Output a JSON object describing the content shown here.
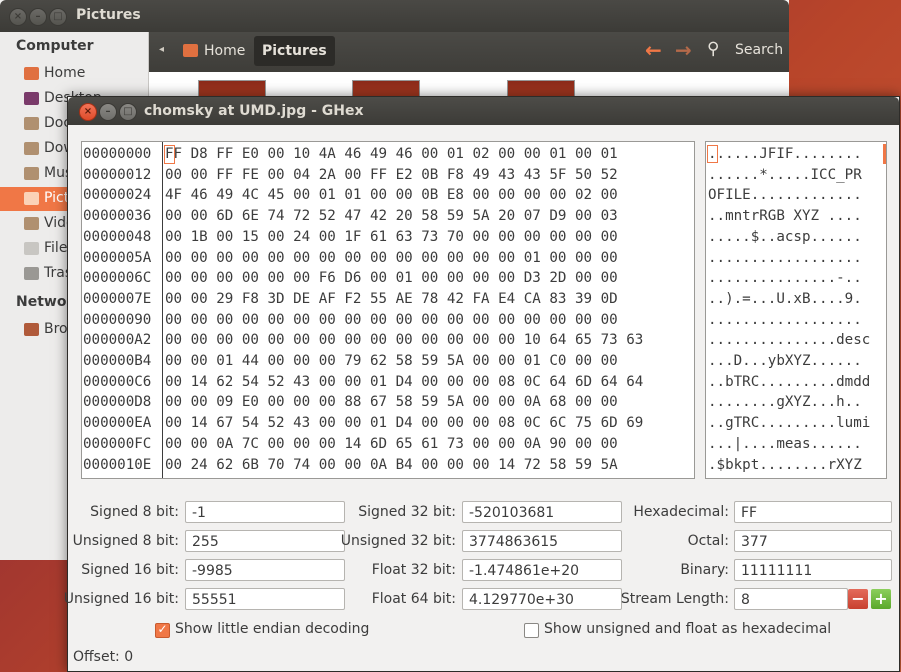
{
  "file_manager": {
    "title": "Pictures",
    "sidebar": {
      "computer_heading": "Computer",
      "items": [
        {
          "label": "Home",
          "icon": "home-folder-icon"
        },
        {
          "label": "Desktop",
          "icon": "desktop-icon"
        },
        {
          "label": "Documents",
          "icon": "documents-folder-icon"
        },
        {
          "label": "Downloads",
          "icon": "downloads-folder-icon"
        },
        {
          "label": "Music",
          "icon": "music-folder-icon"
        },
        {
          "label": "Pictures",
          "icon": "pictures-folder-icon",
          "selected": true
        },
        {
          "label": "Videos",
          "icon": "videos-folder-icon"
        },
        {
          "label": "File System",
          "icon": "filesystem-icon"
        },
        {
          "label": "Trash",
          "icon": "trash-icon"
        }
      ],
      "network_heading": "Network",
      "network_items": [
        {
          "label": "Browse Network",
          "icon": "network-icon"
        }
      ]
    },
    "toolbar": {
      "crumb_home": "Home",
      "crumb_current": "Pictures",
      "search_label": "Search"
    }
  },
  "ghex": {
    "title": "chomsky at UMD.jpg - GHex",
    "hex_rows": [
      {
        "offset": "00000000",
        "hex": "FF D8 FF E0 00 10 4A 46 49 46 00 01 02 00 00 01 00 01",
        "ascii": "......JFIF........"
      },
      {
        "offset": "00000012",
        "hex": "00 00 FF FE 00 04 2A 00 FF E2 0B F8 49 43 43 5F 50 52",
        "ascii": "......*.....ICC_PR"
      },
      {
        "offset": "00000024",
        "hex": "4F 46 49 4C 45 00 01 01 00 00 0B E8 00 00 00 00 02 00",
        "ascii": "OFILE............."
      },
      {
        "offset": "00000036",
        "hex": "00 00 6D 6E 74 72 52 47 42 20 58 59 5A 20 07 D9 00 03",
        "ascii": "..mntrRGB XYZ ...."
      },
      {
        "offset": "00000048",
        "hex": "00 1B 00 15 00 24 00 1F 61 63 73 70 00 00 00 00 00 00",
        "ascii": ".....$..acsp......"
      },
      {
        "offset": "0000005A",
        "hex": "00 00 00 00 00 00 00 00 00 00 00 00 00 00 01 00 00 00",
        "ascii": ".................."
      },
      {
        "offset": "0000006C",
        "hex": "00 00 00 00 00 00 F6 D6 00 01 00 00 00 00 D3 2D 00 00",
        "ascii": "...............-.."
      },
      {
        "offset": "0000007E",
        "hex": "00 00 29 F8 3D DE AF F2 55 AE 78 42 FA E4 CA 83 39 0D",
        "ascii": "..).=...U.xB....9."
      },
      {
        "offset": "00000090",
        "hex": "00 00 00 00 00 00 00 00 00 00 00 00 00 00 00 00 00 00",
        "ascii": ".................."
      },
      {
        "offset": "000000A2",
        "hex": "00 00 00 00 00 00 00 00 00 00 00 00 00 00 10 64 65 73 63",
        "ascii": "...............desc"
      },
      {
        "offset": "000000B4",
        "hex": "00 00 01 44 00 00 00 79 62 58 59 5A 00 00 01 C0 00 00",
        "ascii": "...D...ybXYZ......"
      },
      {
        "offset": "000000C6",
        "hex": "00 14 62 54 52 43 00 00 01 D4 00 00 00 08 0C 64 6D 64 64",
        "ascii": "..bTRC.........dmdd"
      },
      {
        "offset": "000000D8",
        "hex": "00 00 09 E0 00 00 00 88 67 58 59 5A 00 00 0A 68 00 00",
        "ascii": "........gXYZ...h.."
      },
      {
        "offset": "000000EA",
        "hex": "00 14 67 54 52 43 00 00 01 D4 00 00 00 08 0C 6C 75 6D 69",
        "ascii": "..gTRC.........lumi"
      },
      {
        "offset": "000000FC",
        "hex": "00 00 0A 7C 00 00 00 14 6D 65 61 73 00 00 0A 90 00 00",
        "ascii": "...|....meas......"
      },
      {
        "offset": "0000010E",
        "hex": "00 24 62 6B 70 74 00 00 0A B4 00 00 00 14 72 58 59 5A",
        "ascii": ".$bkpt........rXYZ"
      }
    ],
    "fields": {
      "signed8_label": "Signed 8 bit:",
      "signed8_value": "-1",
      "unsigned8_label": "Unsigned 8 bit:",
      "unsigned8_value": "255",
      "signed16_label": "Signed 16 bit:",
      "signed16_value": "-9985",
      "unsigned16_label": "Unsigned 16 bit:",
      "unsigned16_value": "55551",
      "signed32_label": "Signed 32 bit:",
      "signed32_value": "-520103681",
      "unsigned32_label": "Unsigned 32 bit:",
      "unsigned32_value": "3774863615",
      "float32_label": "Float 32 bit:",
      "float32_value": "-1.474861e+20",
      "float64_label": "Float 64 bit:",
      "float64_value": "4.129770e+30",
      "hex_label": "Hexadecimal:",
      "hex_value": "FF",
      "octal_label": "Octal:",
      "octal_value": "377",
      "binary_label": "Binary:",
      "binary_value": "11111111",
      "stream_label": "Stream Length:",
      "stream_value": "8"
    },
    "options": {
      "little_endian_label": "Show little endian decoding",
      "little_endian_checked": true,
      "unsigned_hex_label": "Show unsigned and float as hexadecimal",
      "unsigned_hex_checked": false
    },
    "status": "Offset: 0"
  }
}
